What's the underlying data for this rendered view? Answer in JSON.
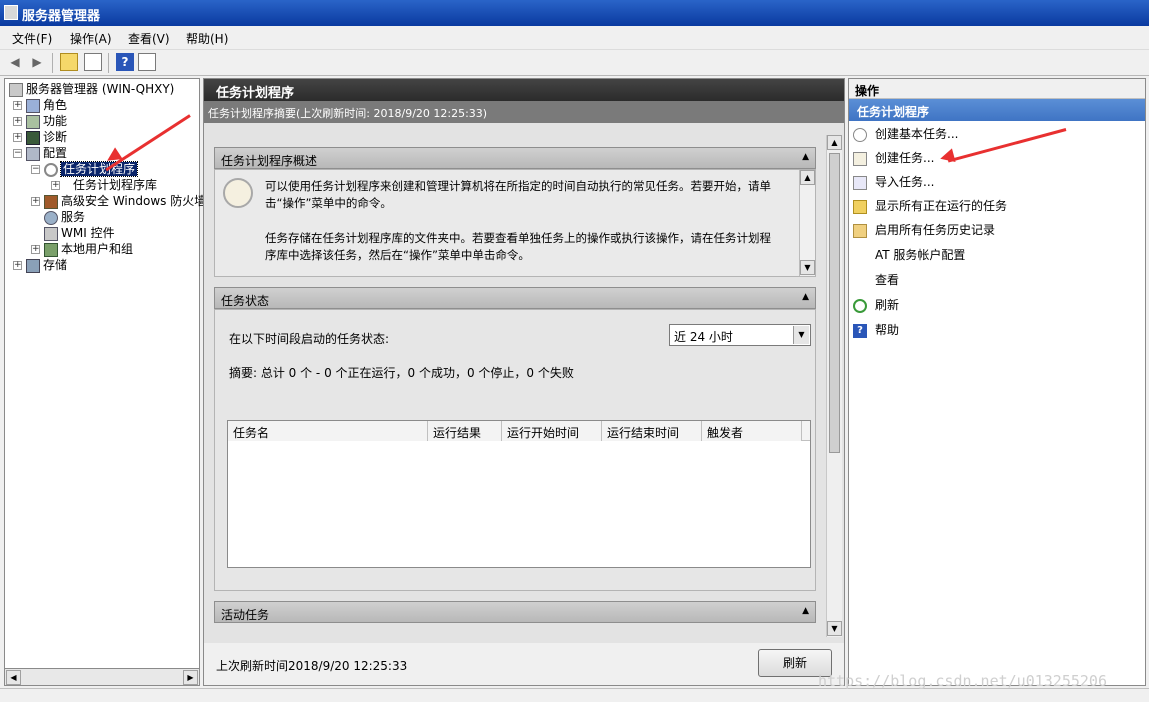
{
  "window": {
    "title": "服务器管理器"
  },
  "menu": [
    "文件(F)",
    "操作(A)",
    "查看(V)",
    "帮助(H)"
  ],
  "tree": {
    "root": "服务器管理器 (WIN-QHXY)",
    "roles": "角色",
    "features": "功能",
    "diagnostics": "诊断",
    "config": "配置",
    "task_scheduler": "任务计划程序",
    "task_library": "任务计划程序库",
    "firewall": "高级安全 Windows 防火墙",
    "services": "服务",
    "wmi": "WMI 控件",
    "local_users": "本地用户和组",
    "storage": "存储"
  },
  "center": {
    "title": "任务计划程序",
    "subtitle": "任务计划程序摘要(上次刷新时间: 2018/9/20 12:25:33)",
    "overview": {
      "header": "任务计划程序概述",
      "para1": "可以使用任务计划程序来创建和管理计算机将在所指定的时间自动执行的常见任务。若要开始，请单击“操作”菜单中的命令。",
      "para2": "任务存储在任务计划程序库的文件夹中。若要查看单独任务上的操作或执行该操作，请在任务计划程序库中选择该任务，然后在“操作”菜单中单击命令。"
    },
    "status": {
      "header": "任务状态",
      "period_label": "在以下时间段启动的任务状态:",
      "period_value": "近 24 小时",
      "summary": "摘要: 总计 0 个 - 0 个正在运行，0 个成功，0 个停止，0 个失败",
      "columns": [
        "任务名",
        "运行结果",
        "运行开始时间",
        "运行结束时间",
        "触发者"
      ]
    },
    "active": {
      "header": "活动任务"
    },
    "footer": {
      "last_refresh": "上次刷新时间2018/9/20 12:25:33",
      "refresh_button": "刷新"
    }
  },
  "actions": {
    "header": "操作",
    "section": "任务计划程序",
    "items": [
      "创建基本任务...",
      "创建任务...",
      "导入任务...",
      "显示所有正在运行的任务",
      "启用所有任务历史记录",
      "AT 服务帐户配置",
      "查看",
      "刷新",
      "帮助"
    ]
  },
  "watermark": "https://blog.csdn.net/u013255206",
  "colors": {
    "title_bar": "#0a3aa0",
    "section_blue": "#3f74c4",
    "panel_dark": "#2b2b2b",
    "annotation_arrow": "#e83030"
  }
}
